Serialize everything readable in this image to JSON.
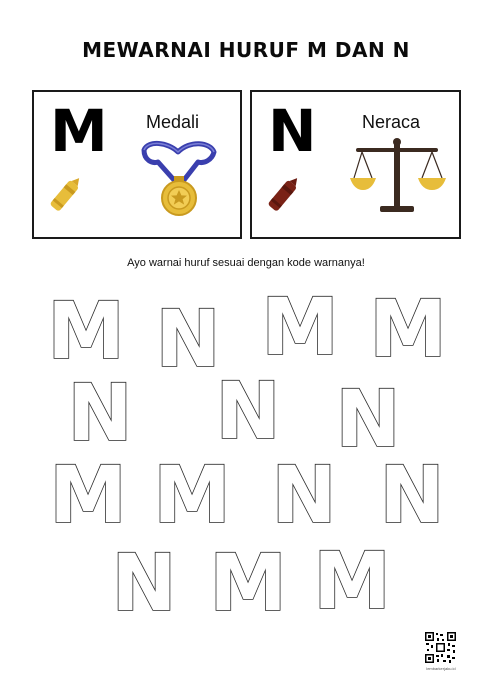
{
  "title": "MEWARNAI HURUF M DAN N",
  "cards": [
    {
      "letter": "M",
      "word": "Medali",
      "crayon_color": "#e7bd3a",
      "picture": "medal-icon"
    },
    {
      "letter": "N",
      "word": "Neraca",
      "crayon_color": "#7a2216",
      "picture": "scale-icon"
    }
  ],
  "instruction": "Ayo warnai huruf sesuai dengan kode warnanya!",
  "letters": {
    "row1": [
      "M",
      "N",
      "M",
      "M"
    ],
    "row2": [
      "N",
      "N",
      "N"
    ],
    "row3": [
      "M",
      "M",
      "N",
      "N"
    ],
    "row4": [
      "N",
      "M",
      "M"
    ]
  },
  "qr_caption": "lembarkerjaku.id",
  "colors": {
    "outline": "#2b2b2b",
    "gold": "#e7bd3a",
    "ribbon": "#3a3fae",
    "bronze": "#7a2216"
  }
}
